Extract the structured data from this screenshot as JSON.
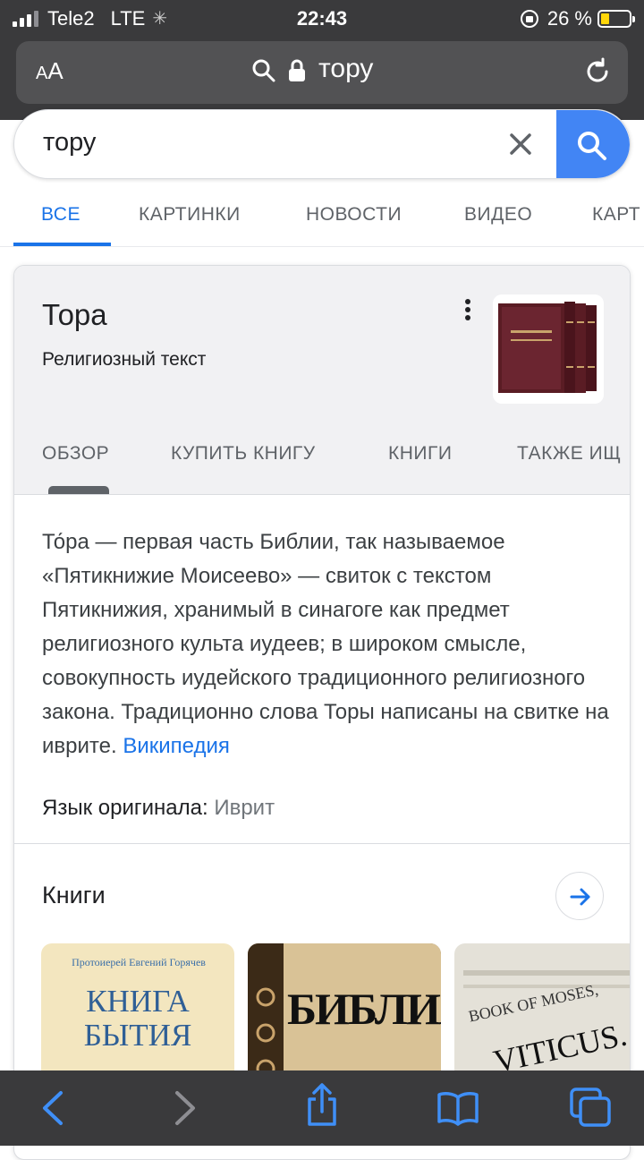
{
  "status_bar": {
    "carrier": "Tele2",
    "network": "LTE",
    "time": "22:43",
    "battery": "26 %"
  },
  "address_bar": {
    "text_size_label": "AA",
    "url_text": "тору"
  },
  "search": {
    "query": "тору"
  },
  "tabs": [
    {
      "label": "ВСЕ",
      "active": true
    },
    {
      "label": "КАРТИНКИ",
      "active": false
    },
    {
      "label": "НОВОСТИ",
      "active": false
    },
    {
      "label": "ВИДЕО",
      "active": false
    },
    {
      "label": "КАРТ",
      "active": false
    }
  ],
  "knowledge_panel": {
    "title": "Тора",
    "subtitle": "Религиозный текст",
    "tabs": [
      "ОБЗОР",
      "КУПИТЬ КНИГУ",
      "КНИГИ",
      "ТАКЖЕ ИЩ"
    ],
    "description": "То́ра — первая часть Библии, так называемое «Пятикнижие Моисеево» — свиток с текстом Пятикнижия, хранимый в синагоге как предмет религиозного культа иудеев; в широком смысле, совокупность иудейского традиционного религиозного закона. Традиционно слова Торы написаны на свитке на иврите.",
    "source_link": "Википедия",
    "original_language_label": "Язык оригинала:",
    "original_language_value": "Иврит",
    "books_heading": "Книги",
    "books": [
      {
        "author": "Протоиерей Евгений Горячев",
        "title_line1": "КНИГА",
        "title_line2": "БЫТИЯ"
      },
      {
        "title": "БИБЛИЯ"
      },
      {
        "line1": "BOOK OF MOSES,",
        "line2": "VITICUS."
      }
    ]
  },
  "colors": {
    "accent": "#1a73e8",
    "search_button": "#4285f4",
    "chrome": "#3a3a3c"
  }
}
